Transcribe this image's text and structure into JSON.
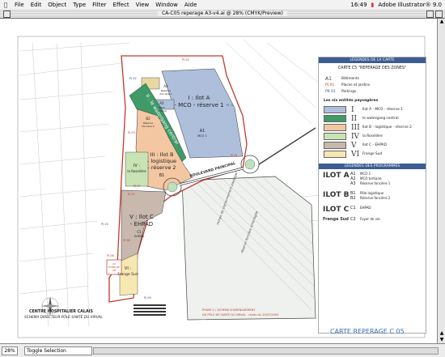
{
  "menubar": {
    "items": [
      "File",
      "Edit",
      "Object",
      "Type",
      "Filter",
      "Effect",
      "View",
      "Window",
      "Aide"
    ],
    "clock": "16:49",
    "app": "Adobe Illustrator® 9.0"
  },
  "window": {
    "title": "CA-C05 reperage A3-v4.ai @ 28% (CMYK/Preview)"
  },
  "status": {
    "zoom": "28%",
    "tool": "Toggle Selection"
  },
  "map": {
    "zones": {
      "A": {
        "line1": "I : Ilot A",
        "line2": "- MCO - réserve 1",
        "sub_code": "A1",
        "sub_label": "MCO 1"
      },
      "A23": {
        "a2": "A2",
        "a2_label": "MCO",
        "a2_label2": "tertiaire",
        "a3": "A3",
        "a3_label": "Réserve",
        "a3_label2": "foncière 1"
      },
      "B": {
        "line1": "III : Ilot B",
        "line2": "- logistique",
        "line3": "- réserve 2",
        "code": "B1"
      },
      "B2": {
        "code": "B2",
        "label": "Réserve",
        "label2": "foncière 2"
      },
      "C": {
        "line1": "V : Ilot C",
        "line2": "- EHPAD",
        "code": "C1",
        "label": "EHPAD"
      },
      "roseliere": {
        "line1": "IV :",
        "line2": "la Roselière"
      },
      "frange": {
        "line1": "VI :",
        "line2": "Frange Sud"
      },
      "foyer": {
        "line1": "C2",
        "line2": "FOYER DE",
        "line3": "VIE"
      }
    },
    "roads": {
      "boulevard": "BOULEVARD PRINCIPAL",
      "rue": "Rue Denis Papin"
    },
    "parkings": [
      "PJ 04",
      "PJ 02",
      "PJ 03",
      "PJ 01",
      "PJ 05",
      "PJ 06",
      "PJ 07",
      "PJ 08",
      "PJ 09",
      "PJ 10",
      "PJ 11"
    ],
    "title_lines": [
      "CENTRE HOSPITALIER CALAIS",
      "SCHEMA DIRECTEUR PÔLE SANTÉ DU VIRVAL"
    ],
    "phase_lines": [
      "PHASE 2 / SCHEMA D'AMENAGEMENT",
      "DU PÔLE DE SANTE DU VIRVAL - rendu du 10/07/2003"
    ],
    "carte_ref": "CARTE REPERAGE  C 05"
  },
  "legend": {
    "header": "LÉGENDES DE LA CARTE",
    "title": "CARTE C5 \"REPERAGE DES ZONES\"",
    "keys": [
      {
        "code": "A1",
        "label": "Bâtiments",
        "color": "#333333"
      },
      {
        "code": "PJ 01",
        "label": "Places et jardins",
        "color": "#c0392b"
      },
      {
        "code": "PK 01",
        "label": "Parkings",
        "color": "#2c4f8a"
      }
    ],
    "entites_title": "Les six entités paysagères",
    "entites": [
      {
        "roman": "I",
        "label": "Ilot A - MCO - réserve 1",
        "color": "#aebfdb"
      },
      {
        "roman": "II",
        "label": "le watergang central",
        "color": "#3f9a68"
      },
      {
        "roman": "III",
        "label": "Ilot B - logistique - réserve 2",
        "color": "#f3c7a2"
      },
      {
        "roman": "IV",
        "label": "la Roselière",
        "color": "#c9e3b5"
      },
      {
        "roman": "V",
        "label": "Ilot C - EHPAD",
        "color": "#c8b8ad"
      },
      {
        "roman": "VI",
        "label": "Frange Sud",
        "color": "#f7e7b0"
      }
    ],
    "prog_header": "LÉGENDES DES PROGRAMMES",
    "programmes": [
      {
        "name": "ILOT A",
        "codes": [
          "A1",
          "A2",
          "A3"
        ],
        "labels": [
          "MCO 1",
          "MCO tertiaire",
          "Réserve foncière 1"
        ]
      },
      {
        "name": "ILOT B",
        "codes": [
          "B1",
          "B2"
        ],
        "labels": [
          "Pôle logistique",
          "Réserve foncière 2"
        ]
      },
      {
        "name": "ILOT C",
        "codes": [
          "C1"
        ],
        "labels": [
          "EHPAD"
        ]
      },
      {
        "name": "Frange Sud",
        "codes": [
          "C2"
        ],
        "labels": [
          "Foyer de vie"
        ]
      }
    ]
  }
}
